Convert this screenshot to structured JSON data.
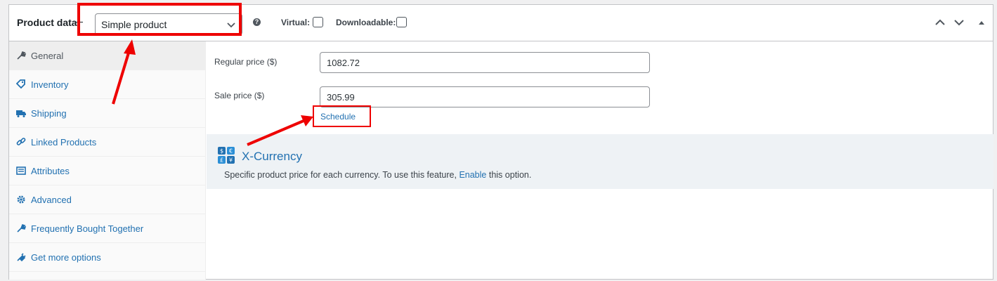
{
  "header": {
    "title": "Product data",
    "product_type": "Simple product",
    "help_glyph": "?",
    "virtual_label": "Virtual:",
    "downloadable_label": "Downloadable:"
  },
  "sidebar": {
    "items": [
      {
        "label": "General",
        "icon": "wrench-icon",
        "active": true
      },
      {
        "label": "Inventory",
        "icon": "tag-icon",
        "active": false
      },
      {
        "label": "Shipping",
        "icon": "truck-icon",
        "active": false
      },
      {
        "label": "Linked Products",
        "icon": "link-icon",
        "active": false
      },
      {
        "label": "Attributes",
        "icon": "list-icon",
        "active": false
      },
      {
        "label": "Advanced",
        "icon": "gear-icon",
        "active": false
      },
      {
        "label": "Frequently Bought Together",
        "icon": "wrench-icon",
        "active": false
      },
      {
        "label": "Get more options",
        "icon": "plug-icon",
        "active": false
      }
    ]
  },
  "pricing": {
    "regular_label": "Regular price ($)",
    "regular_value": "1082.72",
    "sale_label": "Sale price ($)",
    "sale_value": "305.99",
    "schedule_link": "Schedule"
  },
  "xcurrency": {
    "title": "X-Currency",
    "desc_before": "Specific product price for each currency. To use this feature,",
    "enable_link": "Enable",
    "desc_after": "this option."
  },
  "colors": {
    "link": "#2271b1",
    "annotation": "#ee0000",
    "highlight_band": "#eef2f5"
  }
}
